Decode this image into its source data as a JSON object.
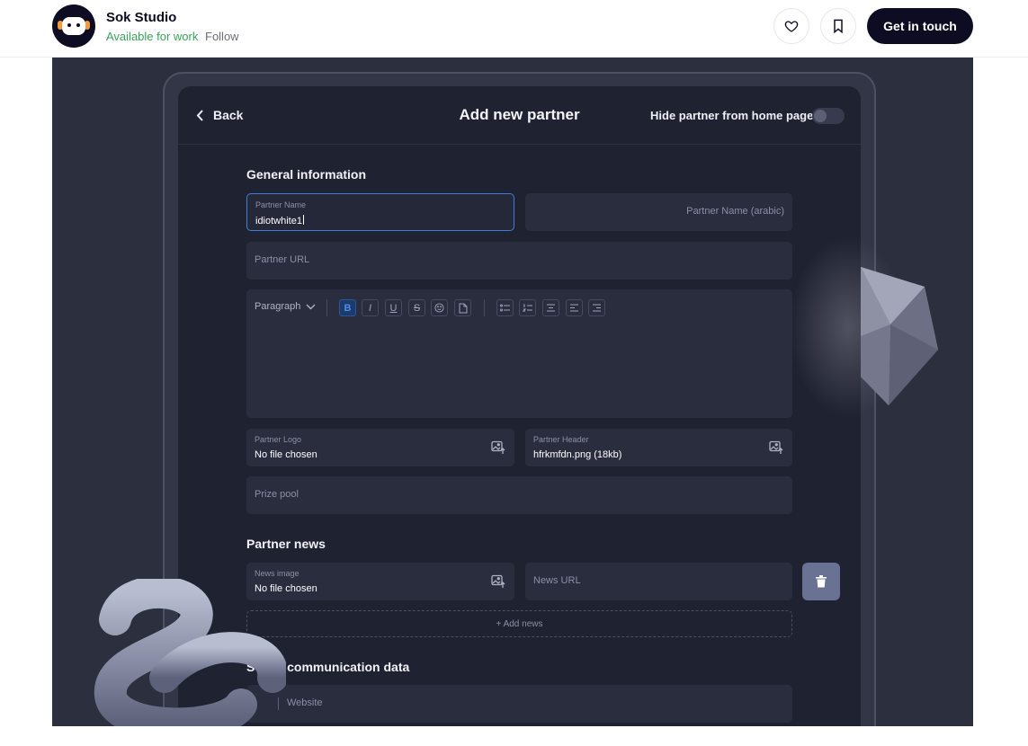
{
  "topbar": {
    "studio_name": "Sok Studio",
    "availability": "Available for work",
    "follow": "Follow",
    "cta": "Get in touch"
  },
  "app": {
    "back": "Back",
    "title": "Add new partner",
    "hide_toggle_label": "Hide partner from home page",
    "hide_toggle_on": false
  },
  "general": {
    "heading": "General information",
    "partner_name_label": "Partner Name",
    "partner_name_value": "idiotwhite1",
    "partner_name_arabic_placeholder": "Partner Name (arabic)",
    "partner_url_placeholder": "Partner URL",
    "editor": {
      "block_style": "Paragraph",
      "toolbar": [
        "B",
        "I",
        "U",
        "S",
        "emoji",
        "file",
        "bullet-list",
        "numbered-list",
        "align-center",
        "align-left",
        "align-right"
      ],
      "active": "B"
    },
    "logo_label": "Partner Logo",
    "logo_value": "No file chosen",
    "header_label": "Partner Header",
    "header_value": "hfrkmfdn.png (18kb)",
    "prize_pool_placeholder": "Prize pool"
  },
  "news": {
    "heading": "Partner news",
    "image_label": "News image",
    "image_value": "No file chosen",
    "url_placeholder": "News URL",
    "add_label": "+ Add news"
  },
  "social": {
    "heading": "Social communication data",
    "website_placeholder": "Website"
  },
  "colors": {
    "background": "#2b2f3e",
    "screen": "#1f2231",
    "field": "#2a2d3e",
    "accent": "#3d7fd8",
    "available": "#3aa35a"
  }
}
